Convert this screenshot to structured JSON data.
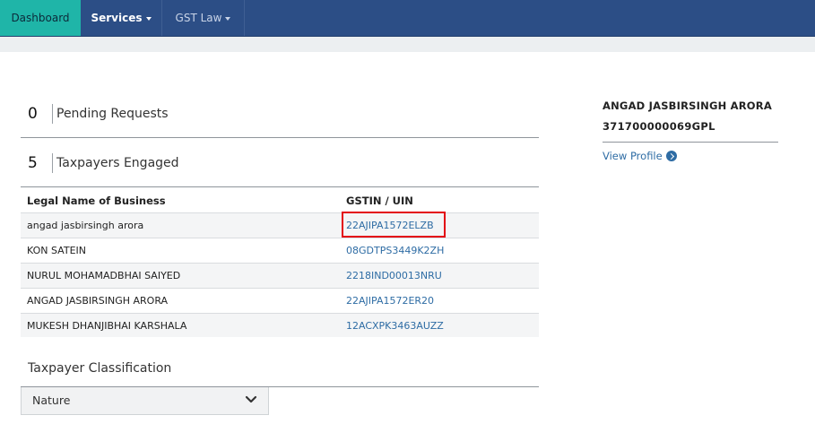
{
  "nav": {
    "items": [
      {
        "label": "Dashboard"
      },
      {
        "label": "Services"
      },
      {
        "label": "GST Law"
      }
    ]
  },
  "stats": {
    "pending": {
      "count": "0",
      "label": "Pending Requests"
    },
    "engaged": {
      "count": "5",
      "label": "Taxpayers Engaged"
    }
  },
  "table": {
    "headers": {
      "name": "Legal Name of Business",
      "gstin": "GSTIN / UIN"
    },
    "rows": [
      {
        "name": "angad jasbirsingh arora",
        "gstin": "22AJIPA1572ELZB"
      },
      {
        "name": "KON SATEIN",
        "gstin": "08GDTPS3449K2ZH"
      },
      {
        "name": "NURUL MOHAMADBHAI SAIYED",
        "gstin": "2218IND00013NRU"
      },
      {
        "name": "ANGAD JASBIRSINGH ARORA",
        "gstin": "22AJIPA1572ER20"
      },
      {
        "name": "MUKESH DHANJIBHAI KARSHALA",
        "gstin": "12ACXPK3463AUZZ"
      }
    ]
  },
  "classification": {
    "title": "Taxpayer Classification",
    "select_value": "Nature"
  },
  "profile": {
    "name": "ANGAD JASBIRSINGH ARORA",
    "id": "371700000069GPL",
    "link_label": "View Profile"
  },
  "colors": {
    "navbar": "#2c4e86",
    "active_tab": "#1fb5a8",
    "link": "#2e6ca4",
    "highlight_box": "#e30613"
  }
}
